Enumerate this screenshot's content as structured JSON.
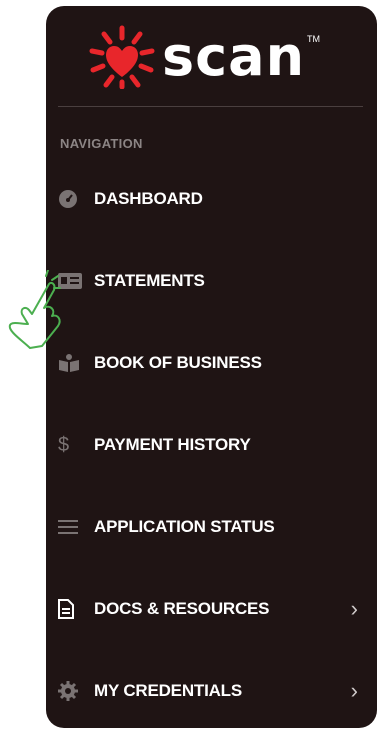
{
  "brand": {
    "name": "scan",
    "trademark": "TM",
    "color": "#e8262b"
  },
  "sidebar": {
    "heading": "NAVIGATION",
    "items": [
      {
        "label": "DASHBOARD",
        "icon": "gauge-icon"
      },
      {
        "label": "STATEMENTS",
        "icon": "id-card-icon"
      },
      {
        "label": "BOOK OF BUSINESS",
        "icon": "book-icon"
      },
      {
        "label": "PAYMENT HISTORY",
        "icon": "dollar-icon"
      },
      {
        "label": "APPLICATION STATUS",
        "icon": "lines-icon"
      },
      {
        "label": "DOCS & RESOURCES",
        "icon": "document-icon",
        "expandable": true
      },
      {
        "label": "MY CREDENTIALS",
        "icon": "gear-icon",
        "expandable": true
      }
    ]
  },
  "colors": {
    "sidebar_bg": "#1f1414",
    "text": "#ffffff",
    "icon": "#7a7373",
    "cursor": "#4caf50"
  }
}
